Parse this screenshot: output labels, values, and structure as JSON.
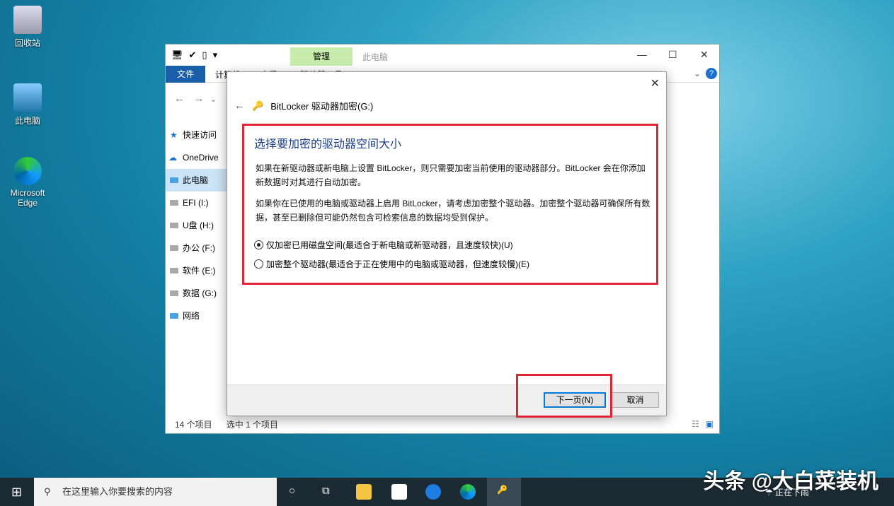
{
  "desktop": {
    "icons": [
      {
        "label": "回收站"
      },
      {
        "label": "此电脑"
      },
      {
        "label": "Microsoft Edge"
      }
    ]
  },
  "explorer": {
    "title": "此电脑",
    "context_tab": "管理",
    "ribbon_tabs": [
      "文件",
      "计算机",
      "查看",
      "驱动器工具"
    ],
    "sidebar": [
      "快速访问",
      "OneDrive",
      "此电脑",
      "EFI (I:)",
      "U盘 (H:)",
      "办公 (F:)",
      "软件 (E:)",
      "数据 (G:)",
      "网络"
    ],
    "status_items": "14 个项目",
    "status_selected": "选中 1 个项目"
  },
  "dialog": {
    "title": "BitLocker 驱动器加密(G:)",
    "heading": "选择要加密的驱动器空间大小",
    "para1": "如果在新驱动器或新电脑上设置 BitLocker，则只需要加密当前使用的驱动器部分。BitLocker 会在你添加新数据时对其进行自动加密。",
    "para2": "如果你在已使用的电脑或驱动器上启用 BitLocker，请考虑加密整个驱动器。加密整个驱动器可确保所有数据，甚至已删除但可能仍然包含可检索信息的数据均受到保护。",
    "options": [
      {
        "label": "仅加密已用磁盘空间(最适合于新电脑或新驱动器，且速度较快)(U)",
        "selected": true
      },
      {
        "label": "加密整个驱动器(最适合于正在使用中的电脑或驱动器，但速度较慢)(E)",
        "selected": false
      }
    ],
    "next": "下一页(N)",
    "cancel": "取消"
  },
  "taskbar": {
    "search_placeholder": "在这里输入你要搜索的内容",
    "weather": "正在下雨"
  },
  "watermark": "头条 @大白菜装机"
}
